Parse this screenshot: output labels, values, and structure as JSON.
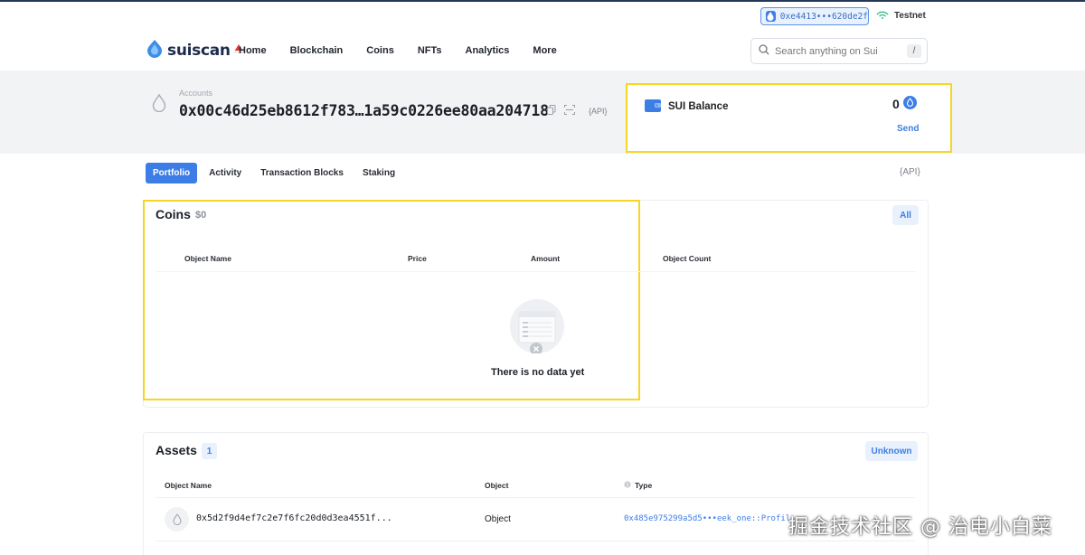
{
  "header": {
    "wallet_address": "0xe4413•••620de2f",
    "network": "Testnet",
    "logo_text": "suiscan",
    "nav": [
      "Home",
      "Blockchain",
      "Coins",
      "NFTs",
      "Analytics",
      "More"
    ],
    "search_placeholder": "Search anything on Sui",
    "search_shortcut": "/"
  },
  "account": {
    "label": "Accounts",
    "address": "0x00c46d25eb8612f783…1a59c0226ee80aa204718",
    "api_label": "{API}"
  },
  "balance": {
    "title": "SUI Balance",
    "value": "0",
    "send_label": "Send"
  },
  "tabs": {
    "items": [
      "Portfolio",
      "Activity",
      "Transaction Blocks",
      "Staking"
    ],
    "active": "Portfolio",
    "api_label": "{API}"
  },
  "coins": {
    "title": "Coins",
    "total": "$0",
    "filter_label": "All",
    "columns": [
      "Object Name",
      "Price",
      "Amount",
      "Object Count"
    ],
    "empty_text": "There is no data yet"
  },
  "assets": {
    "title": "Assets",
    "count": "1",
    "filter_label": "Unknown",
    "columns": [
      "Object Name",
      "Object",
      "Type"
    ],
    "rows": [
      {
        "name": "0x5d2f9d4ef7c2e7f6fc20d0d3ea4551f...",
        "object": "Object",
        "type": "0x485e975299a5d5•••eek_one::Profil"
      }
    ]
  },
  "watermark": "掘金技术社区 @ 治电小白菜",
  "colors": {
    "accent": "#3d7ee6",
    "highlight": "#f7d524",
    "band": "#f2f3f5"
  }
}
